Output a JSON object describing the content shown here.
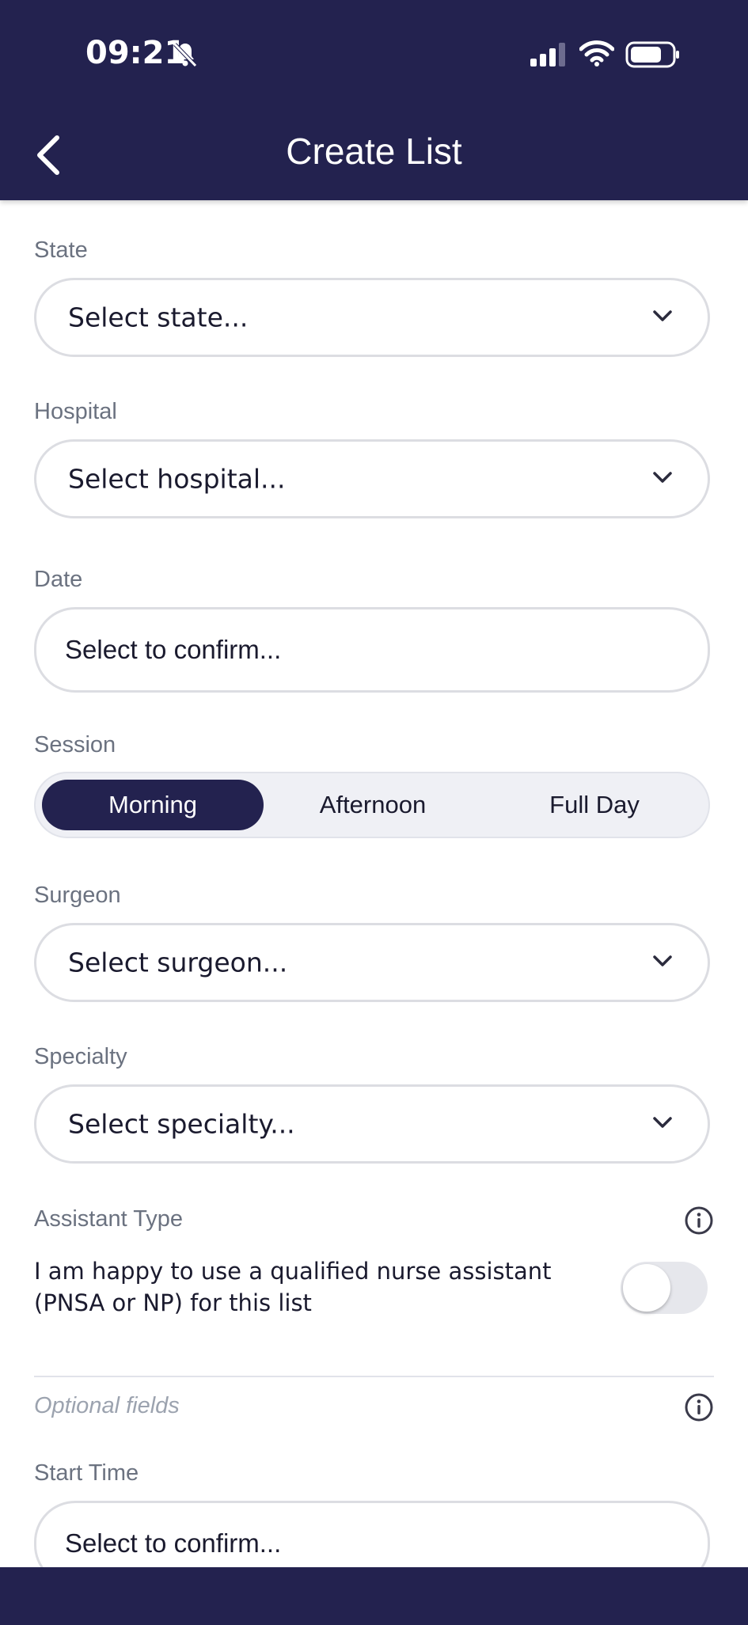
{
  "status_bar": {
    "time": "09:21"
  },
  "header": {
    "title": "Create List"
  },
  "form": {
    "state": {
      "label": "State",
      "placeholder": "Select state..."
    },
    "hospital": {
      "label": "Hospital",
      "placeholder": "Select hospital..."
    },
    "date": {
      "label": "Date",
      "placeholder": "Select to confirm..."
    },
    "session": {
      "label": "Session",
      "options": [
        "Morning",
        "Afternoon",
        "Full Day"
      ],
      "selected": "Morning"
    },
    "surgeon": {
      "label": "Surgeon",
      "placeholder": "Select surgeon..."
    },
    "specialty": {
      "label": "Specialty",
      "placeholder": "Select specialty..."
    },
    "assistant_type": {
      "label": "Assistant Type",
      "toggle_text": "I am happy to use a qualified nurse assistant (PNSA or NP) for this list",
      "toggle_on": false
    },
    "optional_fields_label": "Optional fields",
    "start_time": {
      "label": "Start Time",
      "placeholder": "Select to confirm..."
    }
  },
  "colors": {
    "header_bg": "#23224f",
    "segment_active_bg": "#23224f",
    "label_text": "#6b7280",
    "field_border": "#dcdde2"
  },
  "icons": {
    "back": "chevron-left-icon",
    "dropdown": "chevron-down-icon",
    "info": "info-icon",
    "mute": "bell-slash-icon",
    "signal": "cellular-signal-icon",
    "wifi": "wifi-icon",
    "battery": "battery-icon"
  }
}
